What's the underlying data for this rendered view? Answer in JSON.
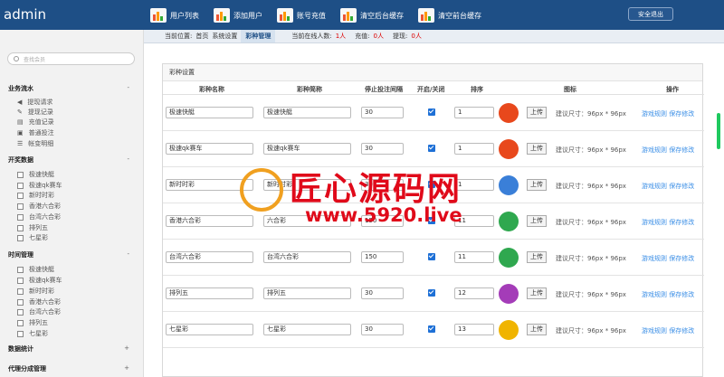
{
  "app": {
    "title": "admin",
    "logout": "安全退出"
  },
  "topnav": [
    "用户列表",
    "添加用户",
    "账号充值",
    "清空后台缓存",
    "清空前台缓存"
  ],
  "sidebar": {
    "search_placeholder": "查找会员",
    "sections": [
      {
        "title": "业务流水",
        "toggle": "-",
        "items": [
          "提现请求",
          "提现记录",
          "充值记录",
          "普通投注",
          "帐变明细"
        ]
      },
      {
        "title": "开奖数据",
        "toggle": "-",
        "items": [
          "极速快艇",
          "极速qk赛车",
          "新时时彩",
          "香港六合彩",
          "台湾六合彩",
          "排列五",
          "七星彩"
        ]
      },
      {
        "title": "时间管理",
        "toggle": "-",
        "items": [
          "极速快艇",
          "极速qk赛车",
          "新时时彩",
          "香港六合彩",
          "台湾六合彩",
          "排列五",
          "七星彩"
        ]
      },
      {
        "title": "数据统计",
        "toggle": "+",
        "items": []
      },
      {
        "title": "代理分成管理",
        "toggle": "+",
        "items": []
      }
    ]
  },
  "breadcrumb": {
    "prefix": "当前位置:",
    "home": "首页",
    "parent": "系统设置",
    "current": "彩种管理",
    "online_label": "当前在线人数:",
    "online_value": "1人",
    "recharge_label": "充值:",
    "recharge_value": "0人",
    "withdraw_label": "提现:",
    "withdraw_value": "0人"
  },
  "panel": {
    "title": "彩种设置",
    "columns": [
      "彩种名称",
      "彩种简称",
      "停止投注间隔",
      "开启/关闭",
      "排序",
      "图标",
      "操作"
    ],
    "upload_label": "上传",
    "hint": "建议尺寸：96px * 96px",
    "op_rules": "游戏规则",
    "op_save": "保存修改",
    "rows": [
      {
        "name": "极速快艇",
        "short": "极速快艇",
        "interval": "30",
        "enabled": true,
        "sort": "1",
        "icon_color": "#e8481c"
      },
      {
        "name": "极速qk赛车",
        "short": "极速qk赛车",
        "interval": "30",
        "enabled": true,
        "sort": "1",
        "icon_color": "#e8481c"
      },
      {
        "name": "新时时彩",
        "short": "新时时彩",
        "interval": "30",
        "enabled": true,
        "sort": "1",
        "icon_color": "#3a7fd8"
      },
      {
        "name": "香港六合彩",
        "short": "六合彩",
        "interval": "150",
        "enabled": true,
        "sort": "11",
        "icon_color": "#2fa84f"
      },
      {
        "name": "台湾六合彩",
        "short": "台湾六合彩",
        "interval": "150",
        "enabled": true,
        "sort": "11",
        "icon_color": "#2fa84f"
      },
      {
        "name": "排列五",
        "short": "排列五",
        "interval": "30",
        "enabled": true,
        "sort": "12",
        "icon_color": "#a43cb8"
      },
      {
        "name": "七星彩",
        "short": "七星彩",
        "interval": "30",
        "enabled": true,
        "sort": "13",
        "icon_color": "#f0b400"
      }
    ]
  },
  "watermark": {
    "title": "匠心源码网",
    "url": "www.5920.live"
  }
}
